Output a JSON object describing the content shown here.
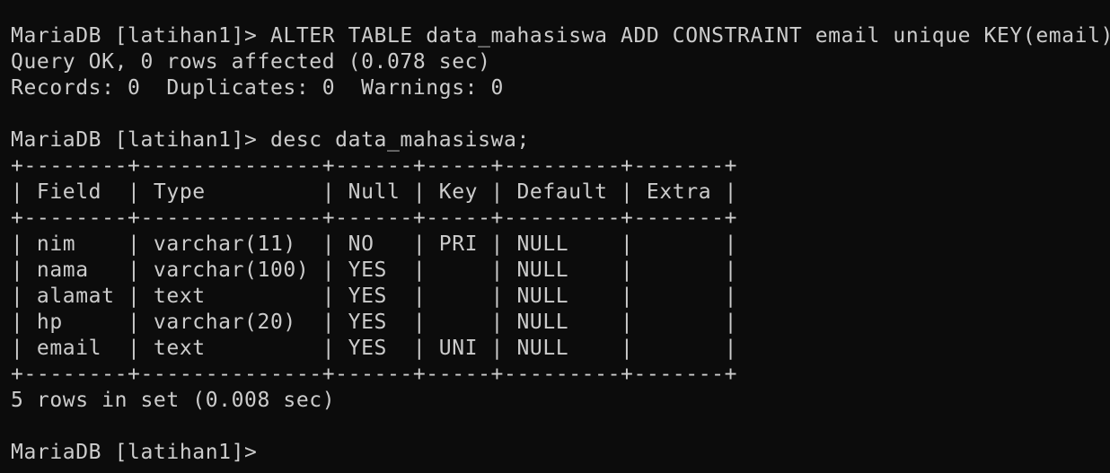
{
  "terminal": {
    "lines": [
      "MariaDB [latihan1]> ALTER TABLE data_mahasiswa ADD CONSTRAINT email unique KEY(email);",
      "Query OK, 0 rows affected (0.078 sec)",
      "Records: 0  Duplicates: 0  Warnings: 0",
      "",
      "MariaDB [latihan1]> desc data_mahasiswa;",
      "+--------+--------------+------+-----+---------+-------+",
      "| Field  | Type         | Null | Key | Default | Extra |",
      "+--------+--------------+------+-----+---------+-------+",
      "| nim    | varchar(11)  | NO   | PRI | NULL    |       |",
      "| nama   | varchar(100) | YES  |     | NULL    |       |",
      "| alamat | text         | YES  |     | NULL    |       |",
      "| hp     | varchar(20)  | YES  |     | NULL    |       |",
      "| email  | text         | YES  | UNI | NULL    |       |",
      "+--------+--------------+------+-----+---------+-------+",
      "5 rows in set (0.008 sec)",
      "",
      "MariaDB [latihan1]>"
    ]
  }
}
